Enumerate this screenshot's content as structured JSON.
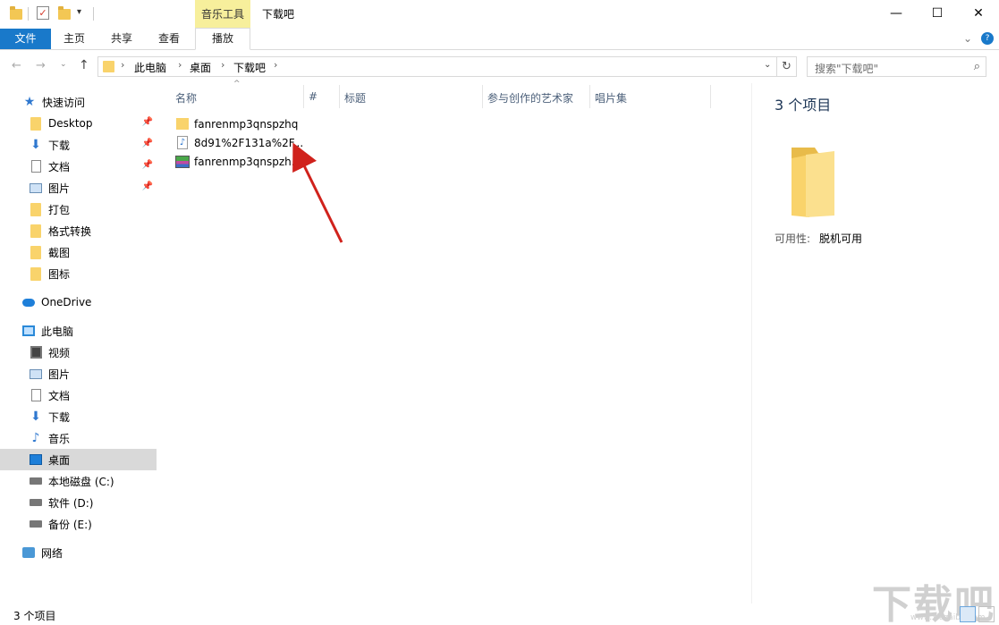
{
  "window": {
    "title": "下载吧",
    "context_tab_group": "音乐工具",
    "minimize": "—",
    "maximize": "☐",
    "close": "✕"
  },
  "ribbon": {
    "tabs": [
      "文件",
      "主页",
      "共享",
      "查看",
      "播放"
    ]
  },
  "address": {
    "breadcrumb": [
      "此电脑",
      "桌面",
      "下载吧"
    ],
    "search_placeholder": "搜索\"下载吧\""
  },
  "nav": {
    "quick_access": "快速访问",
    "quick_items": [
      {
        "label": "Desktop",
        "icon": "folder-icon",
        "pinned": true
      },
      {
        "label": "下载",
        "icon": "download-icon",
        "pinned": true
      },
      {
        "label": "文档",
        "icon": "document-icon",
        "pinned": true
      },
      {
        "label": "图片",
        "icon": "picture-icon",
        "pinned": true
      },
      {
        "label": "打包",
        "icon": "folder-icon",
        "pinned": false
      },
      {
        "label": "格式转换",
        "icon": "folder-icon",
        "pinned": false
      },
      {
        "label": "截图",
        "icon": "folder-icon",
        "pinned": false
      },
      {
        "label": "图标",
        "icon": "folder-icon",
        "pinned": false
      }
    ],
    "onedrive": "OneDrive",
    "this_pc": "此电脑",
    "pc_items": [
      {
        "label": "视频",
        "icon": "video-icon"
      },
      {
        "label": "图片",
        "icon": "picture-icon"
      },
      {
        "label": "文档",
        "icon": "document-icon"
      },
      {
        "label": "下载",
        "icon": "download-icon"
      },
      {
        "label": "音乐",
        "icon": "music-icon"
      },
      {
        "label": "桌面",
        "icon": "desktop-icon",
        "selected": true
      },
      {
        "label": "本地磁盘 (C:)",
        "icon": "drive-icon"
      },
      {
        "label": "软件 (D:)",
        "icon": "drive-icon"
      },
      {
        "label": "备份 (E:)",
        "icon": "drive-icon"
      }
    ],
    "network": "网络"
  },
  "filelist": {
    "columns": [
      "名称",
      "#",
      "标题",
      "参与创作的艺术家",
      "唱片集"
    ],
    "files": [
      {
        "name": "fanrenmp3qnspzhq",
        "type": "folder"
      },
      {
        "name": "8d91%2F131a%2F...",
        "type": "audio"
      },
      {
        "name": "fanrenmp3qnspzh...",
        "type": "archive"
      }
    ]
  },
  "details": {
    "count": "3 个项目",
    "availability_label": "可用性:",
    "availability_value": "脱机可用"
  },
  "status": {
    "text": "3 个项目"
  },
  "watermark": {
    "text": "下载吧",
    "sub": "www.xiazaiba.com"
  },
  "colors": {
    "accent": "#1979ca",
    "context_tab": "#f7ef9c",
    "selected": "#d9d9d9",
    "arrow": "#d0221c"
  }
}
